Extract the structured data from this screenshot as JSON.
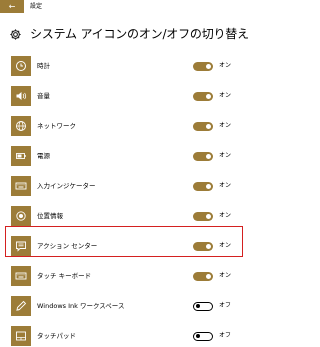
{
  "window": {
    "back_label": "←",
    "title": "設定"
  },
  "header": {
    "title": "システム アイコンのオン/オフの切り替え"
  },
  "items": [
    {
      "label": "時計",
      "state": "オン",
      "on": true,
      "icon": "clock-icon"
    },
    {
      "label": "音量",
      "state": "オン",
      "on": true,
      "icon": "volume-icon"
    },
    {
      "label": "ネットワーク",
      "state": "オン",
      "on": true,
      "icon": "network-icon"
    },
    {
      "label": "電源",
      "state": "オン",
      "on": true,
      "icon": "battery-icon"
    },
    {
      "label": "入力インジケーター",
      "state": "オン",
      "on": true,
      "icon": "keyboard-icon"
    },
    {
      "label": "位置情報",
      "state": "オン",
      "on": true,
      "icon": "location-icon"
    },
    {
      "label": "アクション センター",
      "state": "オン",
      "on": true,
      "icon": "action-center-icon"
    },
    {
      "label": "タッチ キーボード",
      "state": "オン",
      "on": true,
      "icon": "touch-keyboard-icon"
    },
    {
      "label": "Windows Ink ワークスペース",
      "state": "オフ",
      "on": false,
      "icon": "pen-icon"
    },
    {
      "label": "タッチパッド",
      "state": "オフ",
      "on": false,
      "icon": "touchpad-icon"
    }
  ],
  "colors": {
    "accent": "#9c7c38",
    "highlight": "#d42020"
  }
}
